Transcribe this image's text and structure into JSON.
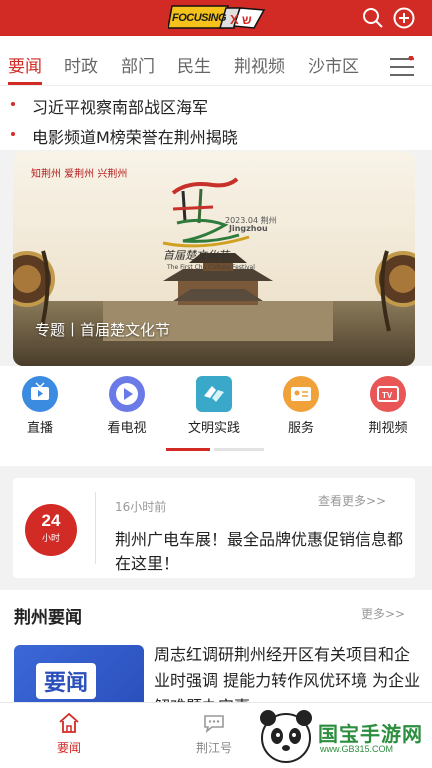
{
  "header": {
    "logo_text": "FOCUSING",
    "search_icon": "search-icon",
    "add_icon": "plus-circle-icon",
    "brand_color": "#d22b26"
  },
  "tabs": [
    {
      "label": "要闻",
      "active": true
    },
    {
      "label": "时政",
      "active": false
    },
    {
      "label": "部门",
      "active": false
    },
    {
      "label": "民生",
      "active": false
    },
    {
      "label": "荆视频",
      "active": false
    },
    {
      "label": "沙市区",
      "active": false
    }
  ],
  "headlines": [
    {
      "text": "习近平视察南部战区海军"
    },
    {
      "text": "电影频道M榜荣誉在荆州揭晓"
    }
  ],
  "banner": {
    "slogan": "知荆州 爱荆州 兴荆州",
    "date": "2023.04 荆州",
    "city_en": "Jingzhou",
    "festival_cn": "首届楚文化节",
    "festival_en": "The First Chu Culture Festival",
    "caption": "专题丨首届楚文化节"
  },
  "quick_nav": [
    {
      "label": "直播",
      "icon": "tv-live-icon",
      "color": "#3b8be0"
    },
    {
      "label": "看电视",
      "icon": "play-circle-icon",
      "color": "#6a7be8"
    },
    {
      "label": "文明实践",
      "icon": "hands-icon",
      "color": "#3aa8c9"
    },
    {
      "label": "服务",
      "icon": "id-card-icon",
      "color": "#f0a13a"
    },
    {
      "label": "荆视频",
      "icon": "tv-icon",
      "color": "#e85656"
    }
  ],
  "news24": {
    "badge_number": "24",
    "badge_unit": "小时",
    "time": "16小时前",
    "more": "查看更多>>",
    "headline": "荆州广电车展！最全品牌优惠促销信息都在这里！"
  },
  "section": {
    "title": "荆州要闻",
    "more": "更多>>",
    "thumb_label": "要闻",
    "news_title": "周志红调研荆州经开区有关项目和企业时强调 提能力转作风优环境 为企业解难题办实事"
  },
  "tabbar": [
    {
      "label": "要闻",
      "icon": "home-icon",
      "active": true
    },
    {
      "label": "荆江号",
      "icon": "chat-icon",
      "active": false
    }
  ],
  "watermark": {
    "text": "国宝手游网",
    "url": "www.GB315.COM"
  }
}
